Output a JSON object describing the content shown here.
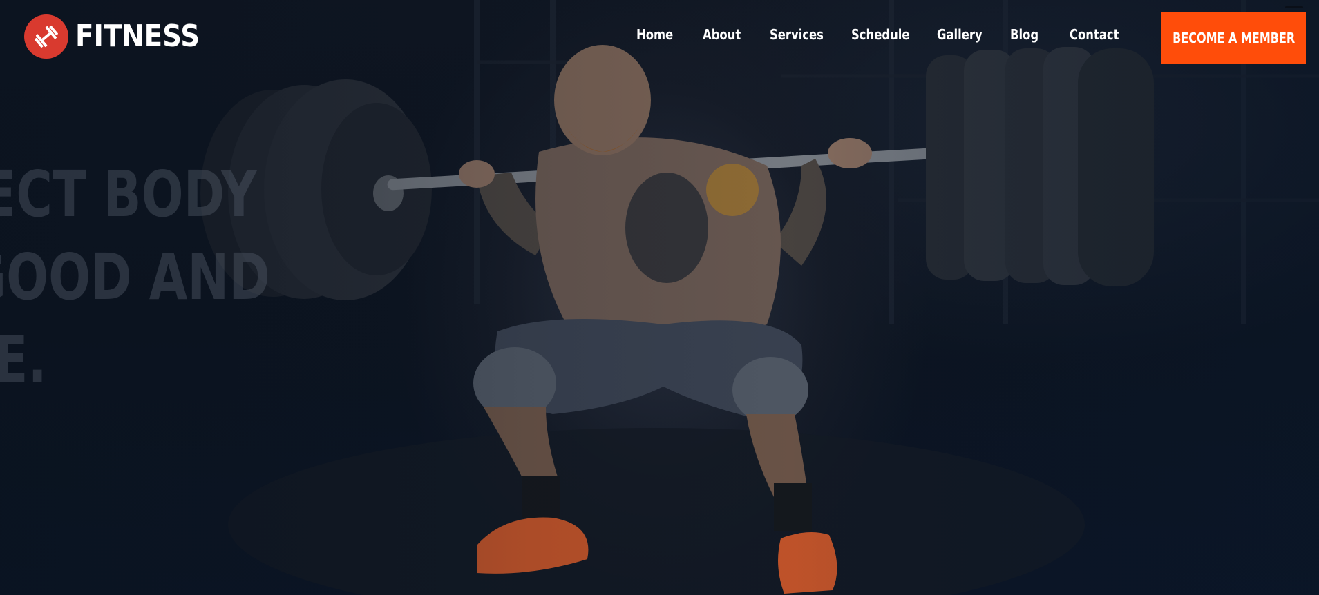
{
  "brand": {
    "name": "FITNESS",
    "accent_color": "#d93a2f",
    "icon": "dumbbell-icon"
  },
  "nav": {
    "items": [
      {
        "label": "Home"
      },
      {
        "label": "About"
      },
      {
        "label": "Services"
      },
      {
        "label": "Schedule"
      },
      {
        "label": "Gallery"
      },
      {
        "label": "Blog"
      },
      {
        "label": "Contact"
      }
    ]
  },
  "cta": {
    "label": "BECOME A MEMBER",
    "color": "#ff4d0a"
  },
  "hero": {
    "lines": [
      "RFECT BODY",
      "R GOOD AND",
      "LIFE."
    ]
  }
}
